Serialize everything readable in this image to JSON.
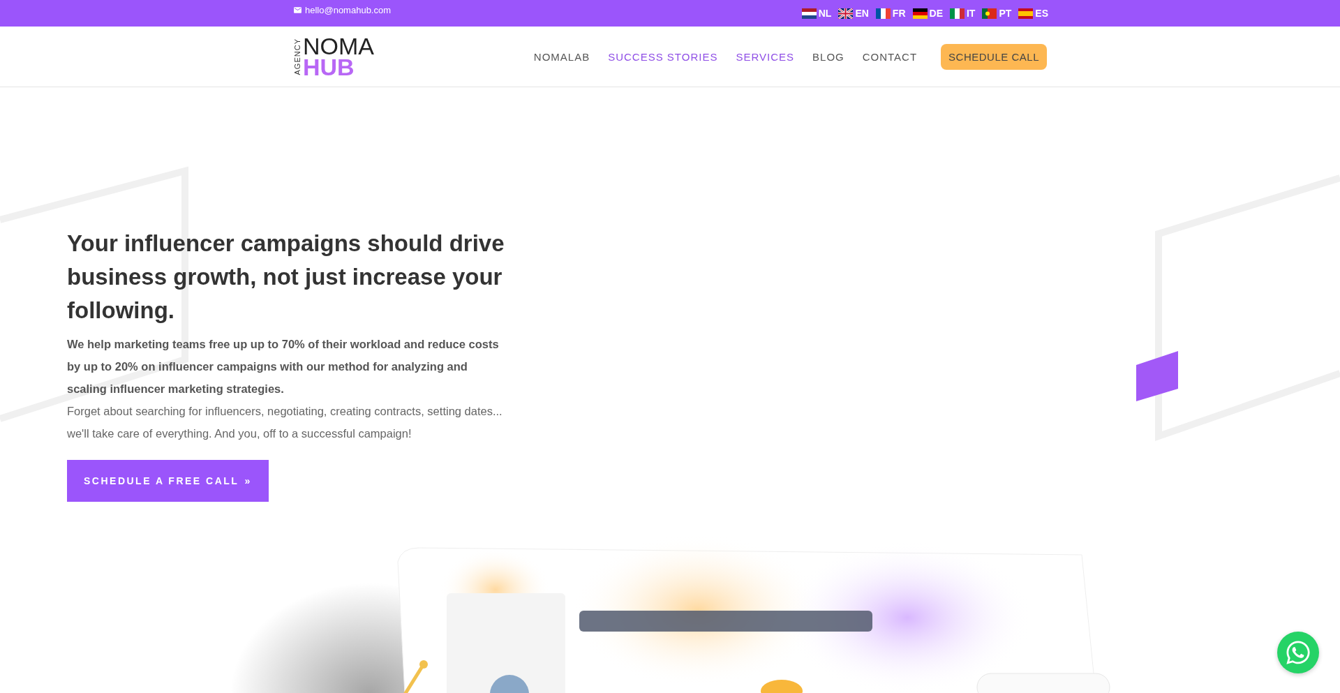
{
  "top_bar": {
    "email": "hello@nomahub.com",
    "languages": [
      {
        "code": "NL",
        "kind": "nl"
      },
      {
        "code": "EN",
        "kind": "gb"
      },
      {
        "code": "FR",
        "kind": "fr"
      },
      {
        "code": "DE",
        "kind": "de"
      },
      {
        "code": "IT",
        "kind": "it"
      },
      {
        "code": "PT",
        "kind": "pt"
      },
      {
        "code": "ES",
        "kind": "es"
      }
    ]
  },
  "header": {
    "logo": {
      "side": "AGENCY",
      "top": "NOMA",
      "bottom": "HUB"
    },
    "nav": [
      {
        "label": "NOMALAB",
        "active": false
      },
      {
        "label": "SUCCESS STORIES",
        "active": true
      },
      {
        "label": "SERVICES",
        "active": true
      },
      {
        "label": "BLOG",
        "active": false
      },
      {
        "label": "CONTACT",
        "active": false
      }
    ],
    "cta": "SCHEDULE CALL"
  },
  "hero": {
    "title": "Your influencer campaigns should drive business growth, not just increase your following.",
    "lead": "We help marketing teams free up up to 70% of their workload and reduce costs by up to 20% on influencer campaigns with our method for analyzing and scaling influencer marketing strategies.",
    "body": "Forget about searching for influencers, negotiating, creating contracts, setting dates... we'll take care of everything. And you, off to a successful campaign!",
    "button": {
      "label": "SCHEDULE A FREE CALL",
      "arrow": "»"
    }
  }
}
